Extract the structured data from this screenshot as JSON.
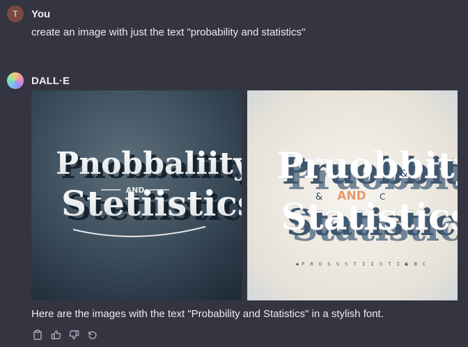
{
  "user": {
    "avatar_letter": "T",
    "name": "You",
    "message": "create an image with just the text \"probability and statistics\""
  },
  "assistant": {
    "name": "DALL·E",
    "image1": {
      "line1": "Pnobbaliity",
      "and": "AND",
      "line2": "Stetiistics"
    },
    "image2": {
      "line1": "Pruobbity",
      "amp_left": "&",
      "and": "AND",
      "c_right": "C",
      "amp_right": "&",
      "line2": "Statistics",
      "small_text": "P R O S S S T I I S T I S B C"
    },
    "caption": "Here are the images with the text \"Probability and Statistics\" in a stylish font."
  },
  "actions": {
    "icons": [
      "clipboard-icon",
      "thumbs-up-icon",
      "thumbs-down-icon",
      "regenerate-icon"
    ]
  },
  "colors": {
    "background": "#343541",
    "text": "#ececf1",
    "icon": "#acacbe"
  }
}
